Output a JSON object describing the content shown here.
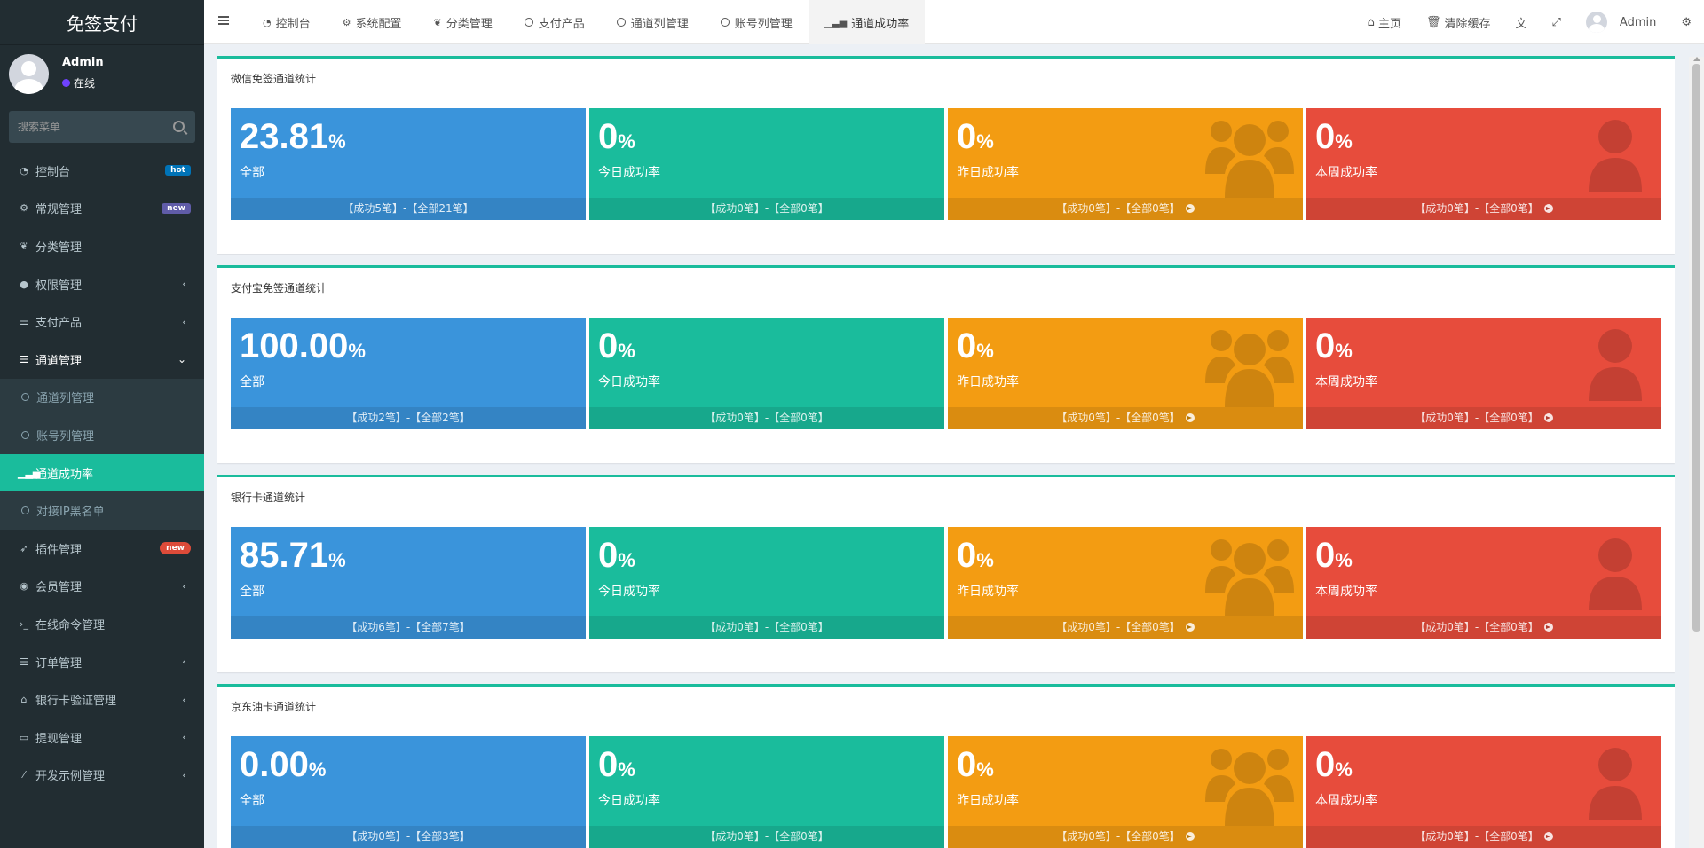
{
  "app": {
    "title": "免签支付"
  },
  "user": {
    "name": "Admin",
    "status": "在线"
  },
  "sidebar": {
    "search_placeholder": "搜索菜单",
    "items": [
      {
        "label": "控制台",
        "icon": "dashboard-icon",
        "badge": "hot"
      },
      {
        "label": "常规管理",
        "icon": "cogs-icon",
        "badge": "new"
      },
      {
        "label": "分类管理",
        "icon": "leaf-icon"
      },
      {
        "label": "权限管理",
        "icon": "users-icon"
      },
      {
        "label": "支付产品",
        "icon": "list-icon"
      },
      {
        "label": "通道管理",
        "icon": "list-icon"
      },
      {
        "label": "通道列管理",
        "icon": "circle-icon"
      },
      {
        "label": "账号列管理",
        "icon": "circle-icon"
      },
      {
        "label": "通道成功率",
        "icon": "signal-icon"
      },
      {
        "label": "对接IP黑名单",
        "icon": "circle-icon"
      },
      {
        "label": "插件管理",
        "icon": "rocket-icon",
        "badge": "new"
      },
      {
        "label": "会员管理",
        "icon": "user-circle-icon"
      },
      {
        "label": "在线命令管理",
        "icon": "terminal-icon"
      },
      {
        "label": "订单管理",
        "icon": "list-icon"
      },
      {
        "label": "银行卡验证管理",
        "icon": "bank-icon"
      },
      {
        "label": "提现管理",
        "icon": "visa-icon"
      },
      {
        "label": "开发示例管理",
        "icon": "magic-icon"
      }
    ]
  },
  "topbar": {
    "tabs": [
      {
        "label": "控制台",
        "icon": "dashboard-icon"
      },
      {
        "label": "系统配置",
        "icon": "cog-icon"
      },
      {
        "label": "分类管理",
        "icon": "leaf-icon"
      },
      {
        "label": "支付产品",
        "icon": "circle-icon"
      },
      {
        "label": "通道列管理",
        "icon": "circle-icon"
      },
      {
        "label": "账号列管理",
        "icon": "circle-icon"
      },
      {
        "label": "通道成功率",
        "icon": "signal-icon"
      }
    ],
    "right": {
      "home": "主页",
      "clear_cache": "清除缓存",
      "user": "Admin"
    }
  },
  "panels": [
    {
      "title": "微信免签通道统计",
      "boxes": [
        {
          "value": "23.81",
          "unit": "%",
          "label": "全部",
          "footer": "【成功5笔】-【全部21笔】"
        },
        {
          "value": "0",
          "unit": "%",
          "label": "今日成功率",
          "footer": "【成功0笔】-【全部0笔】"
        },
        {
          "value": "0",
          "unit": "%",
          "label": "昨日成功率",
          "footer": "【成功0笔】-【全部0笔】"
        },
        {
          "value": "0",
          "unit": "%",
          "label": "本周成功率",
          "footer": "【成功0笔】-【全部0笔】"
        }
      ]
    },
    {
      "title": "支付宝免签通道统计",
      "boxes": [
        {
          "value": "100.00",
          "unit": "%",
          "label": "全部",
          "footer": "【成功2笔】-【全部2笔】"
        },
        {
          "value": "0",
          "unit": "%",
          "label": "今日成功率",
          "footer": "【成功0笔】-【全部0笔】"
        },
        {
          "value": "0",
          "unit": "%",
          "label": "昨日成功率",
          "footer": "【成功0笔】-【全部0笔】"
        },
        {
          "value": "0",
          "unit": "%",
          "label": "本周成功率",
          "footer": "【成功0笔】-【全部0笔】"
        }
      ]
    },
    {
      "title": "银行卡通道统计",
      "boxes": [
        {
          "value": "85.71",
          "unit": "%",
          "label": "全部",
          "footer": "【成功6笔】-【全部7笔】"
        },
        {
          "value": "0",
          "unit": "%",
          "label": "今日成功率",
          "footer": "【成功0笔】-【全部0笔】"
        },
        {
          "value": "0",
          "unit": "%",
          "label": "昨日成功率",
          "footer": "【成功0笔】-【全部0笔】"
        },
        {
          "value": "0",
          "unit": "%",
          "label": "本周成功率",
          "footer": "【成功0笔】-【全部0笔】"
        }
      ]
    },
    {
      "title": "京东油卡通道统计",
      "boxes": [
        {
          "value": "0.00",
          "unit": "%",
          "label": "全部",
          "footer": "【成功0笔】-【全部3笔】"
        },
        {
          "value": "0",
          "unit": "%",
          "label": "今日成功率",
          "footer": "【成功0笔】-【全部0笔】"
        },
        {
          "value": "0",
          "unit": "%",
          "label": "昨日成功率",
          "footer": "【成功0笔】-【全部0笔】"
        },
        {
          "value": "0",
          "unit": "%",
          "label": "本周成功率",
          "footer": "【成功0笔】-【全部0笔】"
        }
      ]
    }
  ],
  "colors": {
    "sidebar_bg": "#222d32",
    "accent": "#1abc9c",
    "blue": "#3a94db",
    "green": "#1abc9c",
    "orange": "#f39c12",
    "red": "#e74c3c"
  }
}
